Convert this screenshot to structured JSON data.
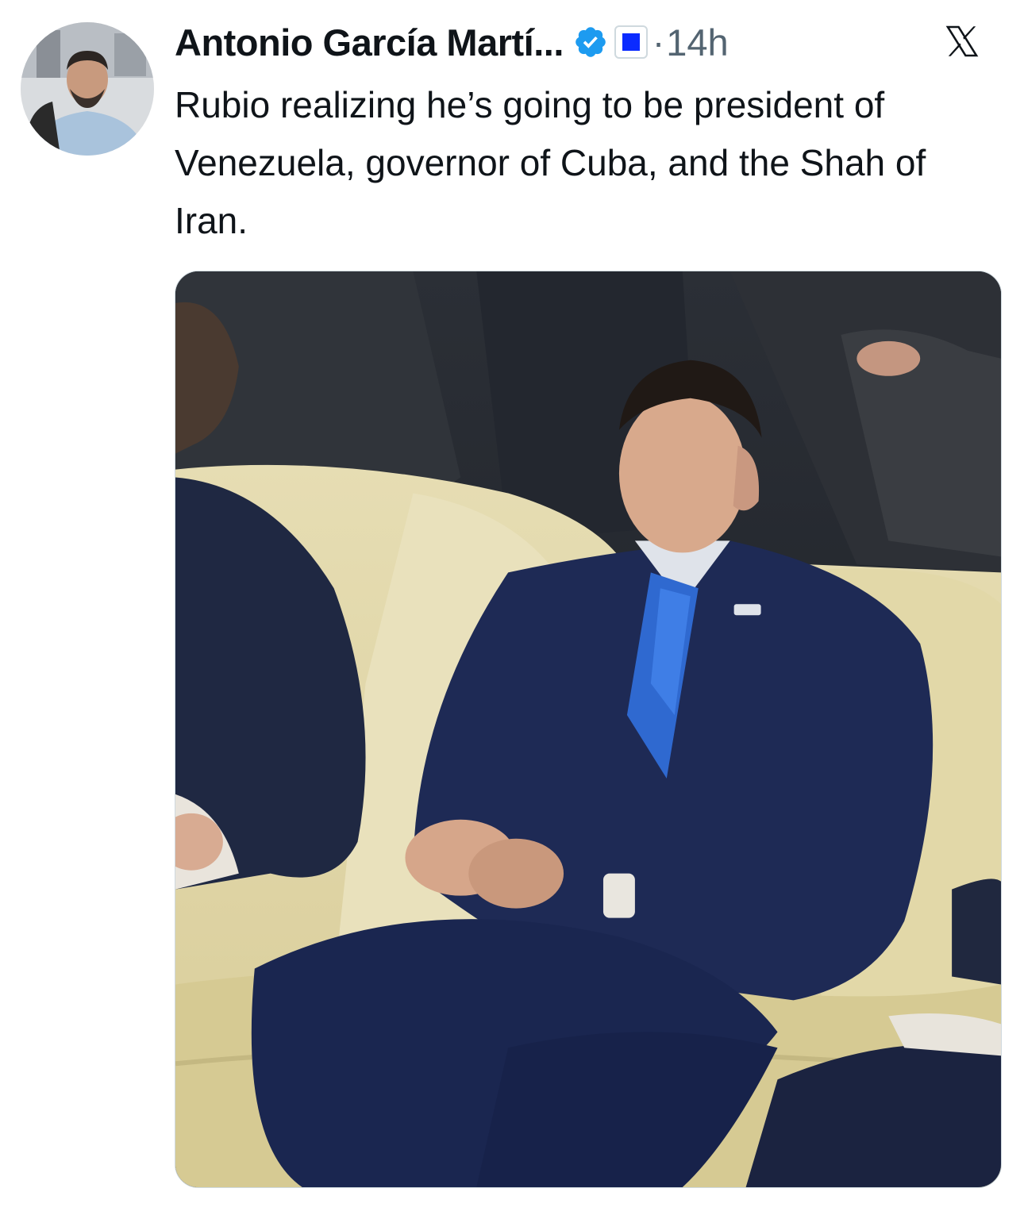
{
  "author": {
    "display_name": "Antonio García Martí...",
    "verified": true,
    "badge_color": "#0b2bff",
    "timestamp_separator": "·",
    "timestamp": "14h"
  },
  "platform_icon": "x-logo-icon",
  "tweet": {
    "text": "Rubio realizing he’s going to be president of Venezuela, governor of Cuba, and the Shah of Iran."
  },
  "colors": {
    "verified_blue": "#1d9bf0",
    "secondary_text": "#536471",
    "primary_text": "#0f1419"
  }
}
